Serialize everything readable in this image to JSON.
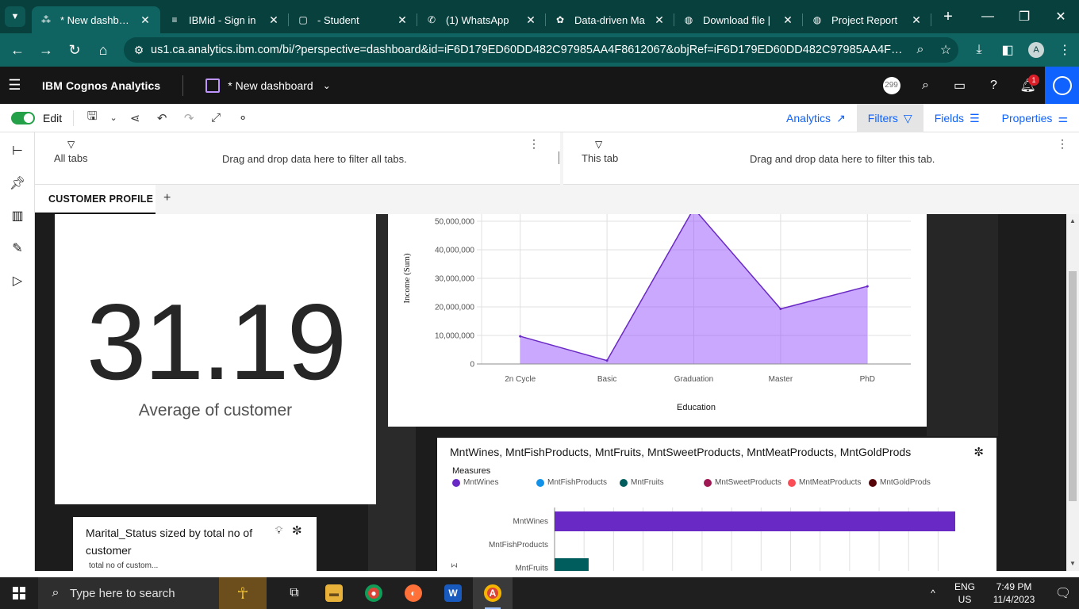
{
  "browser": {
    "tabs": [
      {
        "title": "* New dashboard",
        "icon": "cognos-icon",
        "active": true
      },
      {
        "title": "IBMid - Sign in",
        "icon": "ibm-icon",
        "active": false
      },
      {
        "title": "- Student",
        "icon": "student-icon",
        "active": false
      },
      {
        "title": "(1) WhatsApp",
        "icon": "whatsapp-icon",
        "active": false
      },
      {
        "title": "Data-driven Ma",
        "icon": "openai-icon",
        "active": false
      },
      {
        "title": "Download file |",
        "icon": "globe-icon",
        "active": false
      },
      {
        "title": "Project Report",
        "icon": "globe-icon",
        "active": false
      }
    ],
    "url": "us1.ca.analytics.ibm.com/bi/?perspective=dashboard&id=iF6D179ED60DD482C97985AA4F8612067&objRef=iF6D179ED60DD482C97985AA4F861206...",
    "profile_initial": "A"
  },
  "app": {
    "brand": "IBM Cognos Analytics",
    "dashboard_name": "* New dashboard",
    "count_badge": "299",
    "notification_count": "1"
  },
  "toolbar": {
    "edit_label": "Edit",
    "analytics_label": "Analytics",
    "filters_label": "Filters",
    "fields_label": "Fields",
    "properties_label": "Properties"
  },
  "filters": {
    "all_tabs_label": "All tabs",
    "all_tabs_hint": "Drag and drop data here to filter all tabs.",
    "this_tab_label": "This tab",
    "this_tab_hint": "Drag and drop data here to filter this tab."
  },
  "page_tabs": [
    {
      "label": "CUSTOMER PROFILE",
      "active": true
    }
  ],
  "kpi": {
    "value": "31.19",
    "label": "Average of customer"
  },
  "chart_data": [
    {
      "type": "area",
      "categories": [
        "2n Cycle",
        "Basic",
        "Graduation",
        "Master",
        "PhD"
      ],
      "series": [
        {
          "values": [
            9700000,
            1200000,
            54500000,
            19300000,
            27200000
          ],
          "color": "#8a3ffc"
        }
      ],
      "xlabel": "Education",
      "ylabel": "Income (Sum)",
      "y_ticks": [
        "0",
        "10,000,000",
        "20,000,000",
        "30,000,000",
        "40,000,000",
        "50,000,000"
      ],
      "ylim": [
        0,
        52000000
      ],
      "grid": true
    },
    {
      "type": "bar",
      "orientation": "horizontal",
      "title": "MntWines, MntFishProducts, MntFruits, MntSweetProducts, MntMeatProducts, MntGoldProds",
      "legend_title": "Measures",
      "legend": [
        {
          "name": "MntWines",
          "color": "#6929c4"
        },
        {
          "name": "MntFishProducts",
          "color": "#1192e8"
        },
        {
          "name": "MntFruits",
          "color": "#005d5d"
        },
        {
          "name": "MntSweetProducts",
          "color": "#9f1853"
        },
        {
          "name": "MntMeatProducts",
          "color": "#fa4d56"
        },
        {
          "name": "MntGoldProds",
          "color": "#570408"
        }
      ],
      "categories": [
        "MntWines",
        "MntFishProducts",
        "MntFruits"
      ],
      "values": [
        100,
        0,
        8.5
      ],
      "axis_tag": "Σ",
      "grid": true
    }
  ],
  "marital_widget": {
    "title": "Marital_Status sized by total no of customer",
    "subtitle": "total no of custom..."
  },
  "taskbar": {
    "search_placeholder": "Type here to search",
    "lang_top": "ENG",
    "lang_bottom": "US",
    "time": "7:49 PM",
    "date": "11/4/2023"
  }
}
